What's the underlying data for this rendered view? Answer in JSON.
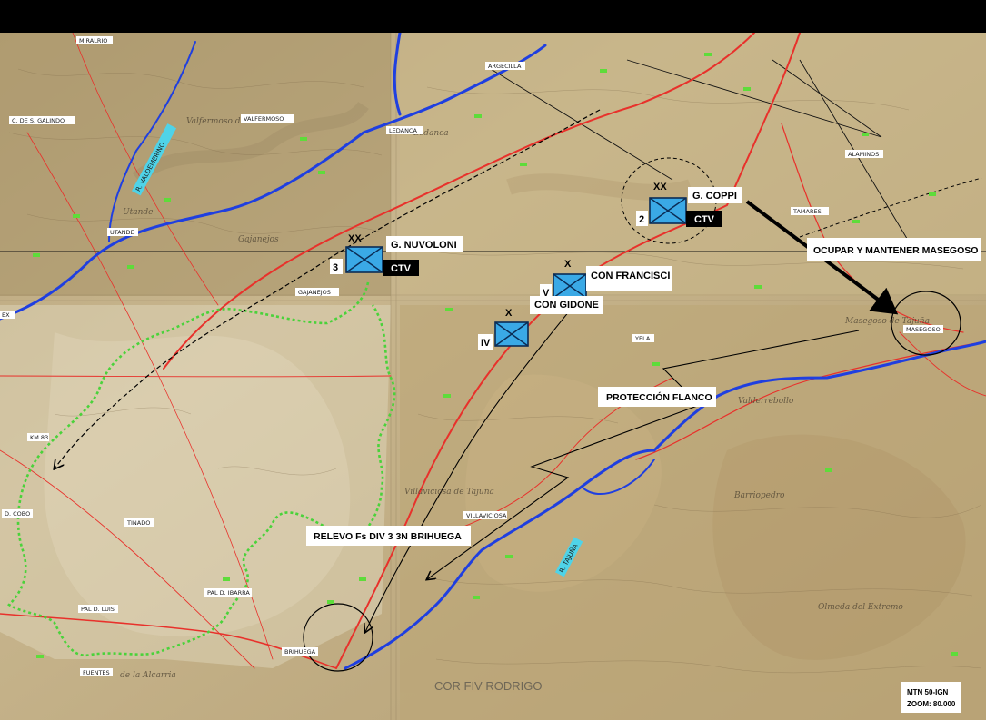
{
  "units": {
    "nuvoloni": {
      "number": "3",
      "name": "G. NUVOLONI",
      "tag": "CTV",
      "echelon": "XX"
    },
    "coppi": {
      "number": "2",
      "name": "G. COPPI",
      "tag": "CTV",
      "echelon": "XX"
    },
    "francisci": {
      "number": "V",
      "name": "CON FRANCISCI",
      "echelon": "X"
    },
    "gidone": {
      "number": "IV",
      "name": "CON GIDONE",
      "echelon": "X"
    }
  },
  "annotations": {
    "ocupar": "OCUPAR Y MANTENER MASEGOSO",
    "proteccion": "PROTECCIÓN FLANCO",
    "relevo": "RELEVO Fs DIV 3  3N BRIHUEGA"
  },
  "places": {
    "miralrio": "MIRALRIO",
    "arroyo": "ARGECILLA",
    "valfermoso": "VALFERMOSO",
    "galindo": "C. DE S. GALINDO",
    "ledanca": "LEDANCA",
    "alaminos": "ALAMINOS",
    "utande": "UTANDE",
    "gajanejos": "GAJANEJOS",
    "yela": "YELA",
    "masegoso": "MASEGOSO",
    "km83": "KM 83",
    "olcobo": "D. COBO",
    "tinado": "TINADO",
    "palibarra": "PAL D. IBARRA",
    "palluis": "PAL D. LUIS",
    "villaviciosa": "VILLAVICIOSA",
    "brihuega": "BRIHUEGA",
    "fuentes": "FUENTES",
    "ex": "EX",
    "tamares": "TAMARES"
  },
  "rivers": {
    "valdemerino": "R. VALDEMERINO",
    "tajuna": "R. TAJUÑA"
  },
  "map_words": {
    "ledanca": "Ledanca",
    "gajanejos": "Gajanejos",
    "valfermoso": "Valfermoso de la",
    "masegoso": "Masegoso de Tajuña",
    "villaviciosa": "Villaviciosa de Tajuña",
    "barriopedro": "Barriopedro",
    "olmeda": "Olmeda del Extremo",
    "valderrebollo": "Valderrebollo",
    "alcarria": "de la Alcarria",
    "utande": "Utande"
  },
  "watermark": "COR FIV RODRIGO",
  "scale": {
    "line1": "MTN 50-IGN",
    "line2": "ZOOM: 80.000"
  },
  "colors": {
    "road": "#e8312b",
    "river": "#1f3fe0",
    "front": "#4ad23a",
    "unit_fill": "#3aa9e6",
    "map_base": "#c9b48a"
  }
}
